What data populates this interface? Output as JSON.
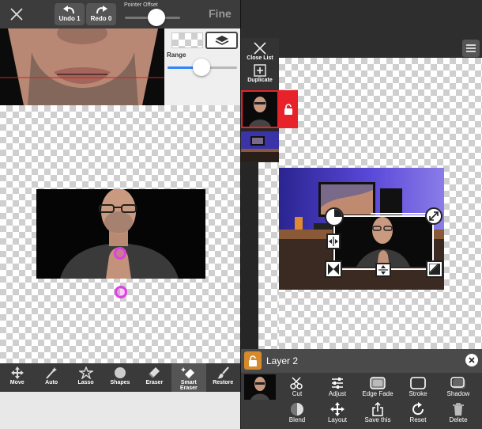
{
  "left_panel": {
    "toolbar": {
      "undo_label": "Undo 1",
      "redo_label": "Redo 0",
      "pointer_offset_label": "Pointer Offset",
      "pointer_offset_value": 0.7,
      "fine_label": "Fine"
    },
    "range_panel": {
      "range_label": "Range",
      "range_value": 0.52
    },
    "tools": [
      {
        "label": "Move",
        "icon": "move-icon"
      },
      {
        "label": "Auto",
        "icon": "magic-wand-icon"
      },
      {
        "label": "Lasso",
        "icon": "lasso-icon"
      },
      {
        "label": "Shapes",
        "icon": "shapes-icon"
      },
      {
        "label": "Eraser",
        "icon": "eraser-icon"
      },
      {
        "label": "Smart Eraser",
        "icon": "smart-eraser-icon",
        "active": true
      },
      {
        "label": "Restore",
        "icon": "brush-icon"
      }
    ]
  },
  "right_panel": {
    "close_list_label": "Close List",
    "duplicate_label": "Duplicate",
    "layer_name": "Layer 2",
    "actions_row1": [
      "Cut",
      "Adjust",
      "Edge Fade",
      "Stroke",
      "Shadow"
    ],
    "actions_row2": [
      "Blend",
      "Layout",
      "Save this",
      "Reset",
      "Delete"
    ],
    "accent_color": "#e8222b"
  }
}
